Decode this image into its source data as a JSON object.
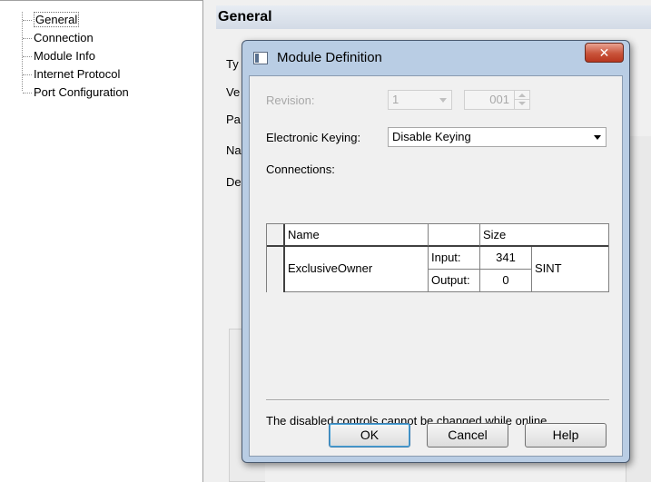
{
  "tree": {
    "items": [
      "General",
      "Connection",
      "Module Info",
      "Internet Protocol",
      "Port Configuration"
    ]
  },
  "panel": {
    "header": "General",
    "labels": [
      "Ty",
      "Ve",
      "Pa",
      "Na",
      "De"
    ]
  },
  "dialog": {
    "title": "Module Definition",
    "close_glyph": "✕",
    "revision_label": "Revision:",
    "revision_major": "1",
    "revision_minor": "001",
    "keying_label": "Electronic Keying:",
    "keying_value": "Disable Keying",
    "connections_label": "Connections:",
    "grid": {
      "col_name": "Name",
      "col_size": "Size",
      "row_name": "ExclusiveOwner",
      "input_label": "Input:",
      "input_value": "341",
      "output_label": "Output:",
      "output_value": "0",
      "type": "SINT"
    },
    "note": "The disabled controls cannot be changed while online.",
    "ok_label": "OK",
    "cancel_label": "Cancel",
    "help_label": "Help"
  }
}
